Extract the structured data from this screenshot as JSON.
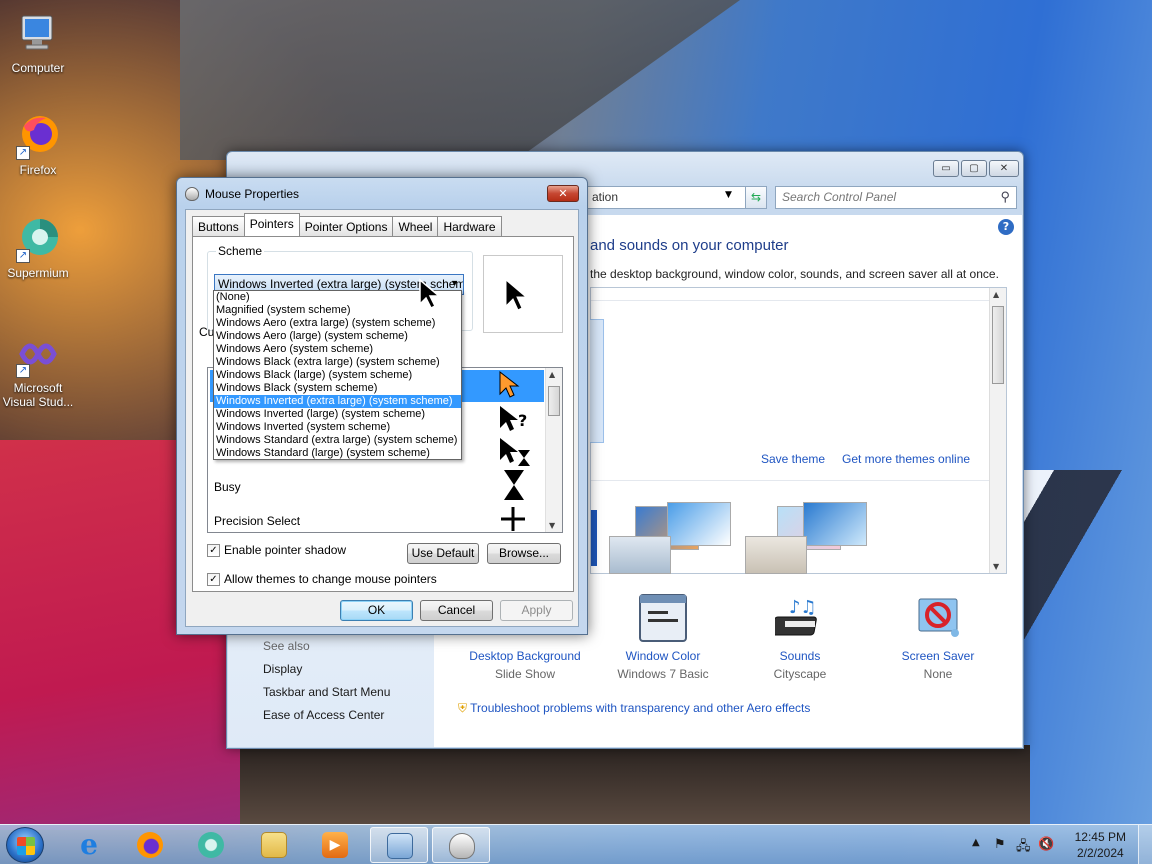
{
  "desktop": {
    "icons": [
      {
        "label": "Computer"
      },
      {
        "label": "Firefox"
      },
      {
        "label": "Supermium"
      },
      {
        "label": "Microsoft Visual Stud..."
      }
    ]
  },
  "control_panel": {
    "address_text": "ation",
    "search_placeholder": "Search Control Panel",
    "heading": "and sounds on your computer",
    "subheading": "the desktop background, window color, sounds, and screen saver all at once.",
    "save_theme": "Save theme",
    "get_more_themes": "Get more themes online",
    "items": [
      {
        "label": "Desktop Background",
        "value": "Slide Show"
      },
      {
        "label": "Window Color",
        "value": "Windows 7 Basic"
      },
      {
        "label": "Sounds",
        "value": "Cityscape"
      },
      {
        "label": "Screen Saver",
        "value": "None"
      }
    ],
    "see_also": {
      "title": "See also",
      "links": [
        "Display",
        "Taskbar and Start Menu",
        "Ease of Access Center"
      ]
    },
    "troubleshoot": "Troubleshoot problems with transparency and other Aero effects",
    "caption_buttons": {
      "minimize": "▭",
      "maximize": "▢",
      "close": "✕"
    },
    "help": "?"
  },
  "mouse_properties": {
    "title": "Mouse Properties",
    "close": "✕",
    "tabs": [
      "Buttons",
      "Pointers",
      "Pointer Options",
      "Wheel",
      "Hardware"
    ],
    "active_tab": "Pointers",
    "scheme_group_label": "Scheme",
    "scheme_selected": "Windows Inverted (extra large) (system scheme)",
    "scheme_options": [
      "(None)",
      "Magnified (system scheme)",
      "Windows Aero (extra large) (system scheme)",
      "Windows Aero (large) (system scheme)",
      "Windows Aero (system scheme)",
      "Windows Black (extra large) (system scheme)",
      "Windows Black (large) (system scheme)",
      "Windows Black (system scheme)",
      "Windows Inverted (extra large) (system scheme)",
      "Windows Inverted (large) (system scheme)",
      "Windows Inverted (system scheme)",
      "Windows Standard (extra large) (system scheme)",
      "Windows Standard (large) (system scheme)"
    ],
    "selected_option_index": 8,
    "customize_partial": "Cu",
    "cursor_rows": [
      {
        "label": "Busy"
      },
      {
        "label": "Precision Select"
      }
    ],
    "enable_shadow": "Enable pointer shadow",
    "enable_shadow_checked": true,
    "allow_themes": "Allow themes to change mouse pointers",
    "allow_themes_checked": true,
    "use_default": "Use Default",
    "browse": "Browse...",
    "ok": "OK",
    "cancel": "Cancel",
    "apply": "Apply"
  },
  "taskbar": {
    "time": "12:45 PM",
    "date": "2/2/2024"
  },
  "colors": {
    "link": "#1f55c2",
    "selection": "#3399ff",
    "heading": "#1e3d8a"
  }
}
